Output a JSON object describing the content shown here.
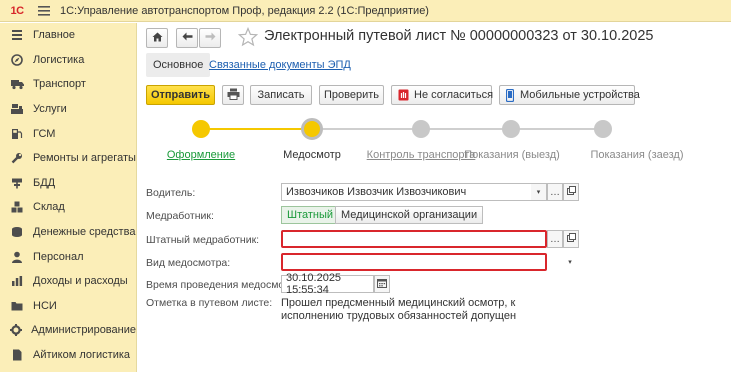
{
  "app": {
    "logo": "1С",
    "title": "1С:Управление автотранспортом Проф, редакция 2.2  (1С:Предприятие)",
    "icons": {
      "menu": "hamburger-icon",
      "star": "star-icon"
    }
  },
  "sidebar": {
    "items": [
      {
        "label": "Главное",
        "icon": "list-icon"
      },
      {
        "label": "Логистика",
        "icon": "compass-icon"
      },
      {
        "label": "Транспорт",
        "icon": "truck-icon"
      },
      {
        "label": "Услуги",
        "icon": "cash-register-icon"
      },
      {
        "label": "ГСМ",
        "icon": "fuel-pump-icon"
      },
      {
        "label": "Ремонты и агрегаты",
        "icon": "wrench-icon"
      },
      {
        "label": "БДД",
        "icon": "road-sign-icon"
      },
      {
        "label": "Склад",
        "icon": "boxes-icon"
      },
      {
        "label": "Денежные средства",
        "icon": "coins-icon"
      },
      {
        "label": "Персонал",
        "icon": "person-icon"
      },
      {
        "label": "Доходы и расходы",
        "icon": "chart-icon"
      },
      {
        "label": "НСИ",
        "icon": "folder-icon"
      },
      {
        "label": "Администрирование",
        "icon": "gear-icon"
      },
      {
        "label": "Айтиком логистика",
        "icon": "document-icon"
      }
    ]
  },
  "header": {
    "title": "Электронный путевой лист № 00000000323 от 30.10.2025"
  },
  "tabs": [
    {
      "label": "Основное"
    },
    {
      "label": "Связанные документы ЭПД"
    }
  ],
  "toolbar": {
    "send": "Отправить",
    "write": "Записать",
    "check": "Проверить",
    "disagree": "Не согласиться",
    "mobile": "Мобильные устройства"
  },
  "stepper": {
    "steps": [
      {
        "label": "Оформление",
        "state": "done"
      },
      {
        "label": "Медосмотр",
        "state": "current"
      },
      {
        "label": "Контроль транспорта",
        "state": "link"
      },
      {
        "label": "Показания (выезд)",
        "state": "pending"
      },
      {
        "label": "Показания (заезд)",
        "state": "pending"
      }
    ],
    "colors": {
      "active": "#f5c800",
      "done_text": "#1a9a3a",
      "pending": "#c8c8c8"
    }
  },
  "form": {
    "driver_label": "Водитель:",
    "driver_value": "Извозчиков Извозчик Извозчикович",
    "medic_label": "Медработник:",
    "medic_options": [
      "Штатный",
      "Медицинской организации"
    ],
    "medic_selected": "Штатный",
    "staff_medic_label": "Штатный медработник:",
    "staff_medic_value": "",
    "exam_type_label": "Вид медосмотра:",
    "exam_type_value": "",
    "exam_time_label": "Время проведения медосмотра:",
    "exam_time_value": "30.10.2025 15:55:34",
    "note_label": "Отметка в путевом листе:",
    "note_value": "Прошел предсменный медицинский осмотр, к исполнению трудовых обязанностей допущен"
  }
}
